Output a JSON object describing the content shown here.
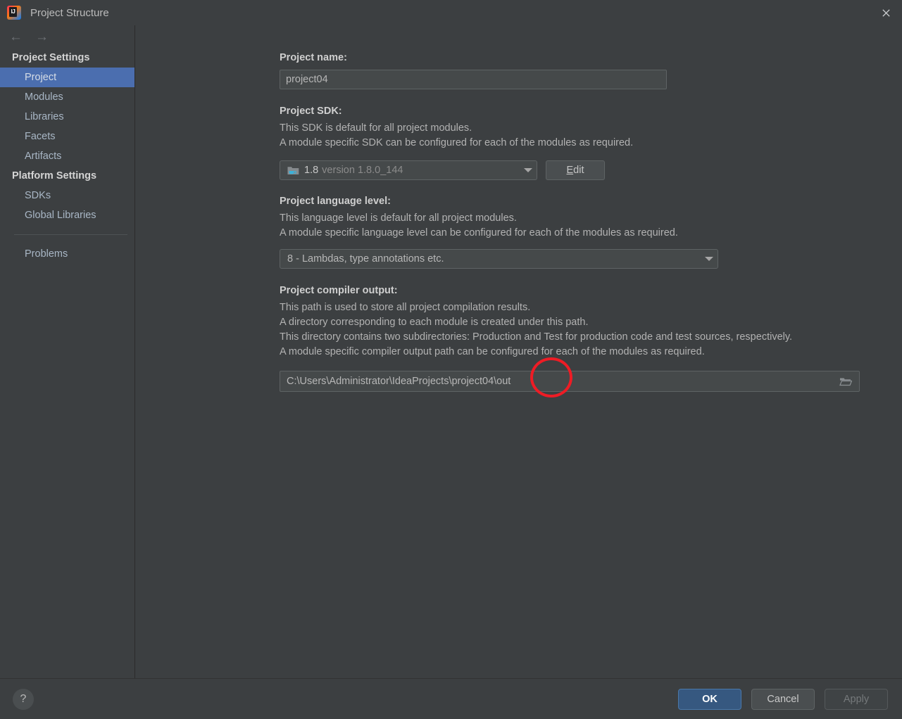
{
  "window": {
    "title": "Project Structure",
    "app_icon": "intellij-idea-logo",
    "close_icon": "close-icon"
  },
  "nav": {
    "back_icon": "←",
    "forward_icon": "→"
  },
  "sidebar": {
    "groups": [
      {
        "title": "Project Settings",
        "items": [
          {
            "label": "Project",
            "selected": true
          },
          {
            "label": "Modules",
            "selected": false
          },
          {
            "label": "Libraries",
            "selected": false
          },
          {
            "label": "Facets",
            "selected": false
          },
          {
            "label": "Artifacts",
            "selected": false
          }
        ]
      },
      {
        "title": "Platform Settings",
        "items": [
          {
            "label": "SDKs",
            "selected": false
          },
          {
            "label": "Global Libraries",
            "selected": false
          }
        ]
      }
    ],
    "extra": {
      "label": "Problems"
    }
  },
  "main": {
    "project_name": {
      "label": "Project name:",
      "value": "project04"
    },
    "project_sdk": {
      "label": "Project SDK:",
      "desc_line1": "This SDK is default for all project modules.",
      "desc_line2": "A module specific SDK can be configured for each of the modules as required.",
      "sdk_name": "1.8",
      "sdk_version": "version 1.8.0_144",
      "sdk_icon": "java-sdk-folder-icon",
      "edit_button": "Edit",
      "edit_mnemonic": "E",
      "edit_rest": "dit"
    },
    "language_level": {
      "label": "Project language level:",
      "desc_line1": "This language level is default for all project modules.",
      "desc_line2": "A module specific language level can be configured for each of the modules as required.",
      "value": "8 - Lambdas, type annotations etc."
    },
    "compiler_output": {
      "label": "Project compiler output:",
      "desc_line1": "This path is used to store all project compilation results.",
      "desc_line2": "A directory corresponding to each module is created under this path.",
      "desc_line3": "This directory contains two subdirectories: Production and Test for production code and test sources, respectively.",
      "desc_line4": "A module specific compiler output path can be configured for each of the modules as required.",
      "path": "C:\\Users\\Administrator\\IdeaProjects\\project04\\out",
      "browse_icon": "folder-open-icon"
    }
  },
  "annotation": {
    "type": "red-ellipse-highlight",
    "color": "#ee1c25"
  },
  "footer": {
    "help_label": "?",
    "ok_label": "OK",
    "cancel_label": "Cancel",
    "apply_label": "Apply"
  },
  "colors": {
    "background": "#3c3f41",
    "selection": "#4b6eaf",
    "accent_button": "#365880",
    "annotation": "#ee1c25"
  }
}
